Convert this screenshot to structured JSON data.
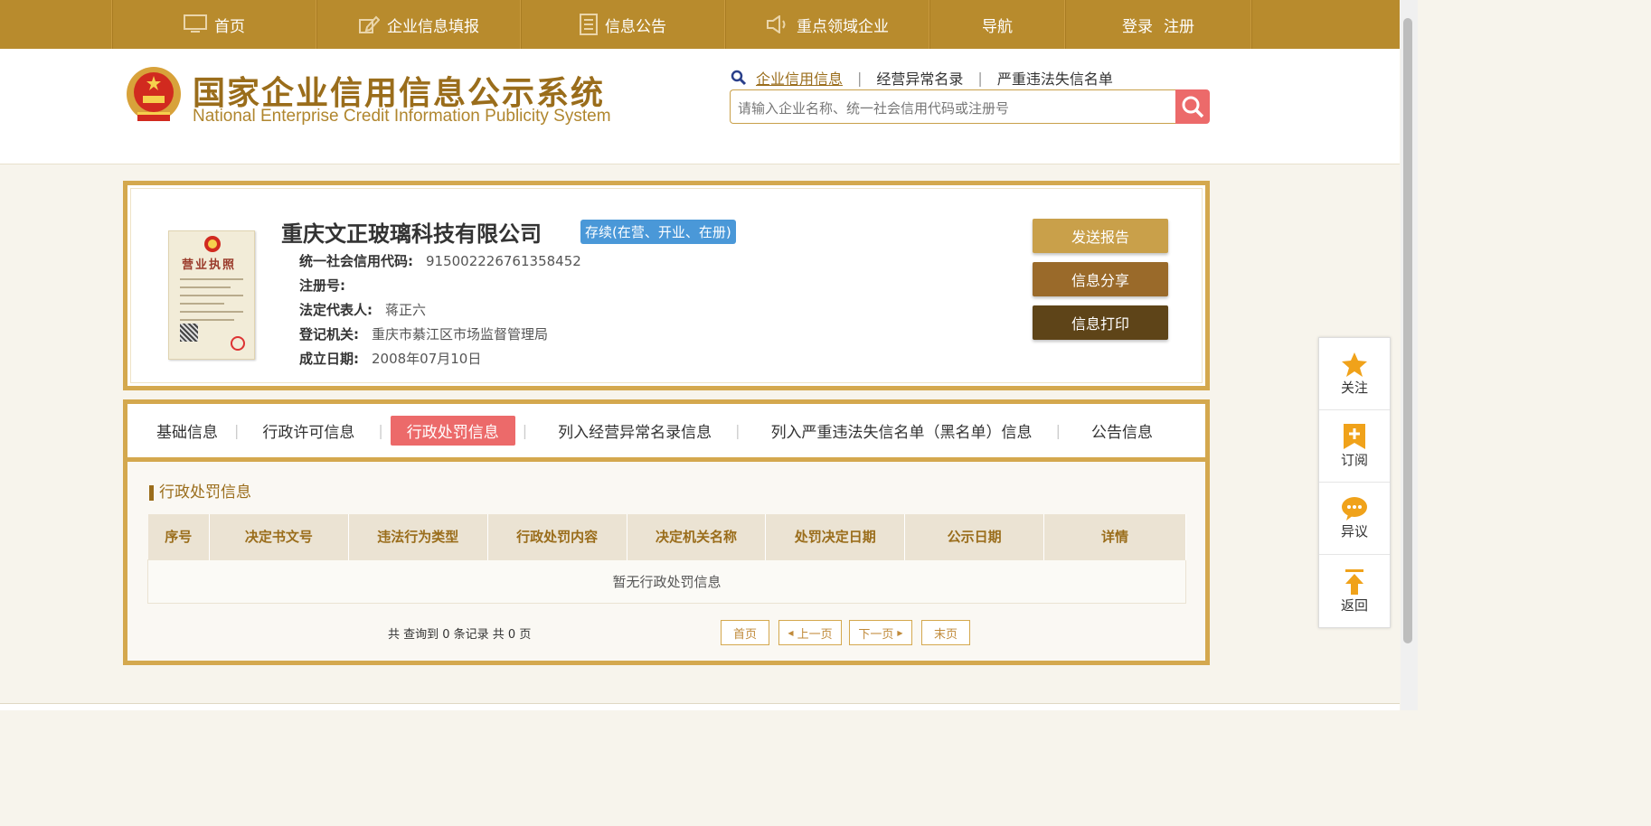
{
  "nav": {
    "items": [
      {
        "label": "首页",
        "icon": "monitor-icon"
      },
      {
        "label": "企业信息填报",
        "icon": "edit-icon"
      },
      {
        "label": "信息公告",
        "icon": "document-icon"
      },
      {
        "label": "重点领域企业",
        "icon": "speaker-icon"
      },
      {
        "label": "导航",
        "icon": ""
      },
      {
        "label": "登录",
        "icon": ""
      }
    ],
    "register_label": "注册"
  },
  "header": {
    "title_cn": "国家企业信用信息公示系统",
    "title_en": "National Enterprise Credit Information Publicity System",
    "search_tabs": [
      "企业信用信息",
      "经营异常名录",
      "严重违法失信名单"
    ],
    "search_placeholder": "请输入企业名称、统一社会信用代码或注册号"
  },
  "company": {
    "name": "重庆文正玻璃科技有限公司",
    "status": "存续(在营、开业、在册)",
    "license_title": "营业执照",
    "fields": {
      "credit_code_label": "统一社会信用代码:",
      "credit_code": "915002226761358452",
      "reg_no_label": "注册号:",
      "reg_no": "",
      "legal_rep_label": "法定代表人:",
      "legal_rep": "蒋正六",
      "authority_label": "登记机关:",
      "authority": "重庆市綦江区市场监督管理局",
      "founded_label": "成立日期:",
      "founded": "2008年07月10日"
    },
    "buttons": {
      "send": "发送报告",
      "share": "信息分享",
      "print": "信息打印"
    },
    "colors": {
      "send": "#c9a04a",
      "share": "#9a6a2a",
      "print": "#5e4418"
    }
  },
  "tabs": [
    {
      "label": "基础信息"
    },
    {
      "label": "行政许可信息"
    },
    {
      "label": "行政处罚信息"
    },
    {
      "label": "列入经营异常名录信息"
    },
    {
      "label": "列入严重违法失信名单（黑名单）信息"
    },
    {
      "label": "公告信息"
    }
  ],
  "section": {
    "title": "行政处罚信息",
    "columns": [
      "序号",
      "决定书文号",
      "违法行为类型",
      "行政处罚内容",
      "决定机关名称",
      "处罚决定日期",
      "公示日期",
      "详情"
    ],
    "empty_text": "暂无行政处罚信息"
  },
  "pager": {
    "info": "共 查询到 0 条记录 共 0 页",
    "first": "首页",
    "prev": "上一页",
    "next": "下一页",
    "last": "末页"
  },
  "float_menu": [
    {
      "label": "关注",
      "icon": "star-icon"
    },
    {
      "label": "订阅",
      "icon": "bookmark-plus-icon"
    },
    {
      "label": "异议",
      "icon": "chat-bubble-icon"
    },
    {
      "label": "返回",
      "icon": "arrow-up-icon"
    }
  ]
}
